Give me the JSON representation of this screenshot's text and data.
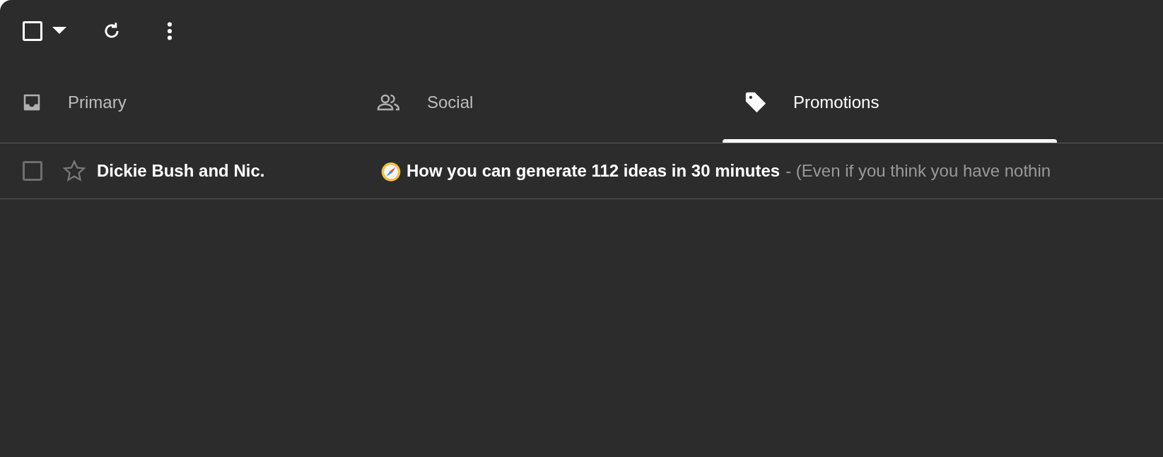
{
  "select_all": {
    "checked": false
  },
  "tabs": [
    {
      "label": "Primary",
      "kind": "inbox",
      "selected": false
    },
    {
      "label": "Social",
      "kind": "people",
      "selected": false
    },
    {
      "label": "Promotions",
      "kind": "tag",
      "selected": true
    }
  ],
  "emails": [
    {
      "checked": false,
      "starred": false,
      "unread": true,
      "sender": "Dickie Bush and Nic.",
      "subject": "How you can generate 112 ideas in 30 minutes",
      "snippet": "- (Even if you think you have nothin"
    }
  ]
}
